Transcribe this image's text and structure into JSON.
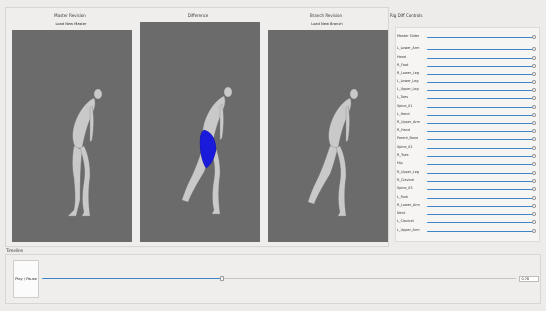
{
  "panels": {
    "master": {
      "title": "Master Revision",
      "load_label": "Load New Master"
    },
    "difference": {
      "title": "Difference"
    },
    "branch": {
      "title": "Branch Revision",
      "load_label": "Load New Branch"
    }
  },
  "rig": {
    "title": "Rig Diff Controls",
    "sliders": [
      "Master Slider",
      "L_Lower_Arm",
      "Head",
      "R_Foot",
      "R_Lower_Leg",
      "L_Lower_Leg",
      "L_Upper_Leg",
      "L_Toes",
      "Spine_01",
      "L_Hand",
      "R_Upper_Arm",
      "R_Hand",
      "Parent_Bone",
      "Spine_02",
      "R_Toes",
      "Hip",
      "R_Upper_Leg",
      "R_Clavicel",
      "Spine_03",
      "L_Foot",
      "R_Lower_Arm",
      "Neck",
      "L_Clavicel",
      "L_Upper_Arm"
    ]
  },
  "timeline": {
    "title": "Timeline",
    "play_label": "Play / Pause",
    "value": "0.78",
    "progress": 0.38
  },
  "colors": {
    "accent": "#3f86c8",
    "viewport_bg": "#6b6b6b",
    "diff_highlight": "#1a1adb"
  }
}
